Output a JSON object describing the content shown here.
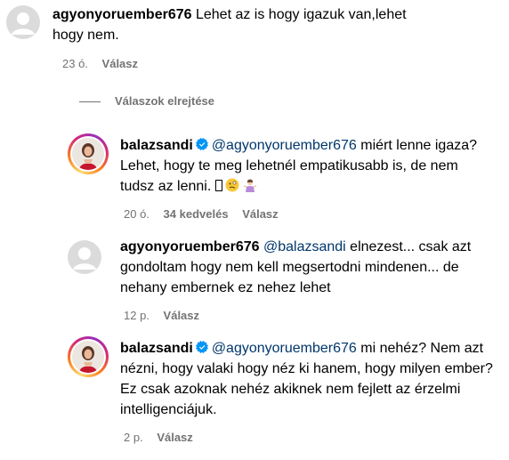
{
  "comments": [
    {
      "username": "agyonyoruember676",
      "text": "Lehet az is hogy igazuk van,lehet hogy nem.",
      "time": "23 ó.",
      "reply_label": "Válasz"
    },
    {
      "username": "balazsandi",
      "mention": "@agyonyoruember676",
      "text": "miért lenne igaza? Lehet, hogy te meg lehetnél empatikusabb is, de nem tudsz az lenni.",
      "time": "20 ó.",
      "likes": "34 kedvelés",
      "reply_label": "Válasz"
    },
    {
      "username": "agyonyoruember676",
      "mention": "@balazsandi",
      "text": "elnezest... csak azt gondoltam hogy nem kell megsertodni mindenen... de nehany embernek ez nehez lehet",
      "time": "12 p.",
      "reply_label": "Válasz"
    },
    {
      "username": "balazsandi",
      "mention": "@agyonyoruember676",
      "text": "mi nehéz? Nem azt nézni, hogy valaki hogy néz ki hanem, hogy milyen ember? Ez csak azoknak nehéz akiknek nem fejlett az érzelmi intelligenciájuk.",
      "time": "2 p.",
      "reply_label": "Válasz"
    }
  ],
  "hide_replies_label": "Válaszok elrejtése",
  "colors": {
    "username": "#000000",
    "mention": "#00376b",
    "meta": "#737373",
    "verified": "#0095f6"
  },
  "icons": {
    "verified": "verified-badge-icon",
    "default_avatar": "default-avatar-icon",
    "emoji_face": "woozy-face-emoji",
    "emoji_person": "person-shrugging-emoji"
  }
}
